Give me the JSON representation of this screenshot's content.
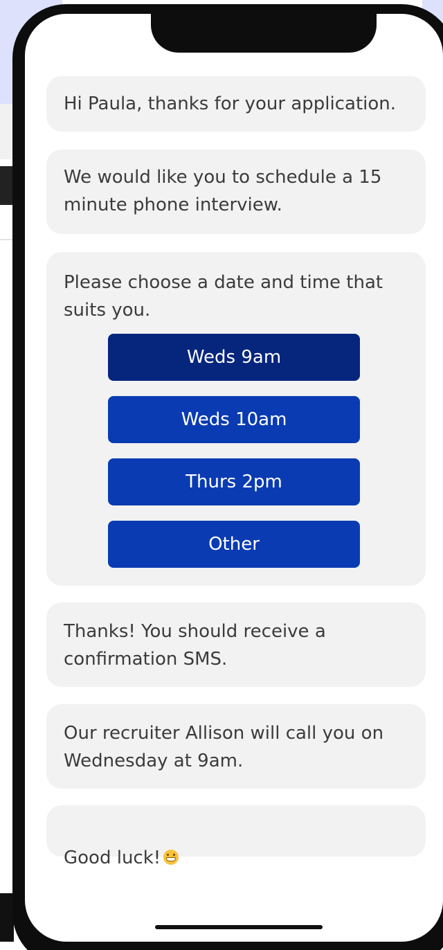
{
  "chat": {
    "messages": [
      {
        "text": "Hi Paula, thanks for your application."
      },
      {
        "text": "We would like you to schedule a 15\nminute phone interview."
      },
      {
        "text": "Please choose a date and time that\nsuits you."
      },
      {
        "text": "Thanks! You should receive a\nconfirmation SMS."
      },
      {
        "text": "Our recruiter Allison will call you on\nWednesday at 9am."
      },
      {
        "text": "Good luck!",
        "emoji": "grinning-face-icon"
      }
    ],
    "options": [
      {
        "label": "Weds 9am",
        "selected": true
      },
      {
        "label": "Weds 10am",
        "selected": false
      },
      {
        "label": "Thurs 2pm",
        "selected": false
      },
      {
        "label": "Other",
        "selected": false
      }
    ]
  },
  "colors": {
    "button": "#0a3bb2",
    "button_selected": "#06257d",
    "bubble": "#f2f2f2",
    "backdrop": "#dde1fb"
  }
}
